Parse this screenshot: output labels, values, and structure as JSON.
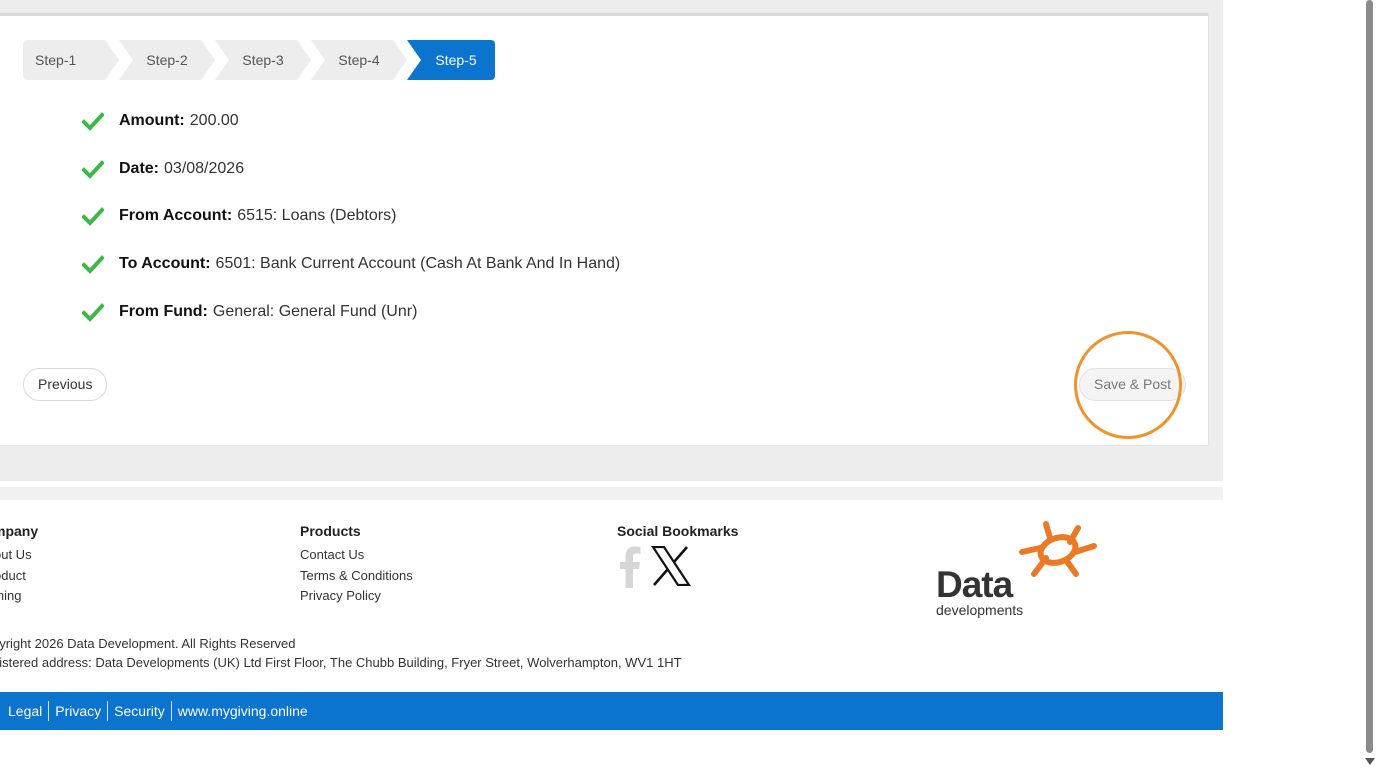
{
  "steps": [
    "Step-1",
    "Step-2",
    "Step-3",
    "Step-4",
    "Step-5"
  ],
  "active_step": "Step-5",
  "summary": [
    {
      "key": "Amount:",
      "value": "200.00"
    },
    {
      "key": "Date:",
      "value": "03/08/2026"
    },
    {
      "key": "From Account:",
      "value": "6515: Loans (Debtors)"
    },
    {
      "key": "To Account:",
      "value": "6501: Bank Current Account (Cash At Bank And In Hand)"
    },
    {
      "key": "From Fund:",
      "value": "General: General Fund (Unr)"
    }
  ],
  "buttons": {
    "previous": "Previous",
    "save_post": "Save & Post"
  },
  "footer": {
    "company": {
      "heading": "mpany",
      "links": [
        "out Us",
        "oduct",
        "ining"
      ]
    },
    "products": {
      "heading": "Products",
      "links": [
        "Contact Us",
        "Terms & Conditions",
        "Privacy Policy"
      ]
    },
    "social": {
      "heading": "Social Bookmarks",
      "icons": [
        "facebook-icon",
        "x-icon"
      ]
    },
    "logo": {
      "word": "Data",
      "sub": "developments"
    },
    "copyright": "pyright 2026 Data Development. All Rights Reserved",
    "address": "gistered address: Data Developments (UK) Ltd First Floor, The Chubb Building, Fryer Street, Wolverhampton, WV1 1HT"
  },
  "bottom_links": [
    "Legal",
    "Privacy",
    "Security",
    "www.mygiving.online"
  ],
  "colors": {
    "accent": "#0a74cf",
    "check": "#3db847",
    "highlight": "#f0922e",
    "logo_orange": "#ea7a25"
  }
}
